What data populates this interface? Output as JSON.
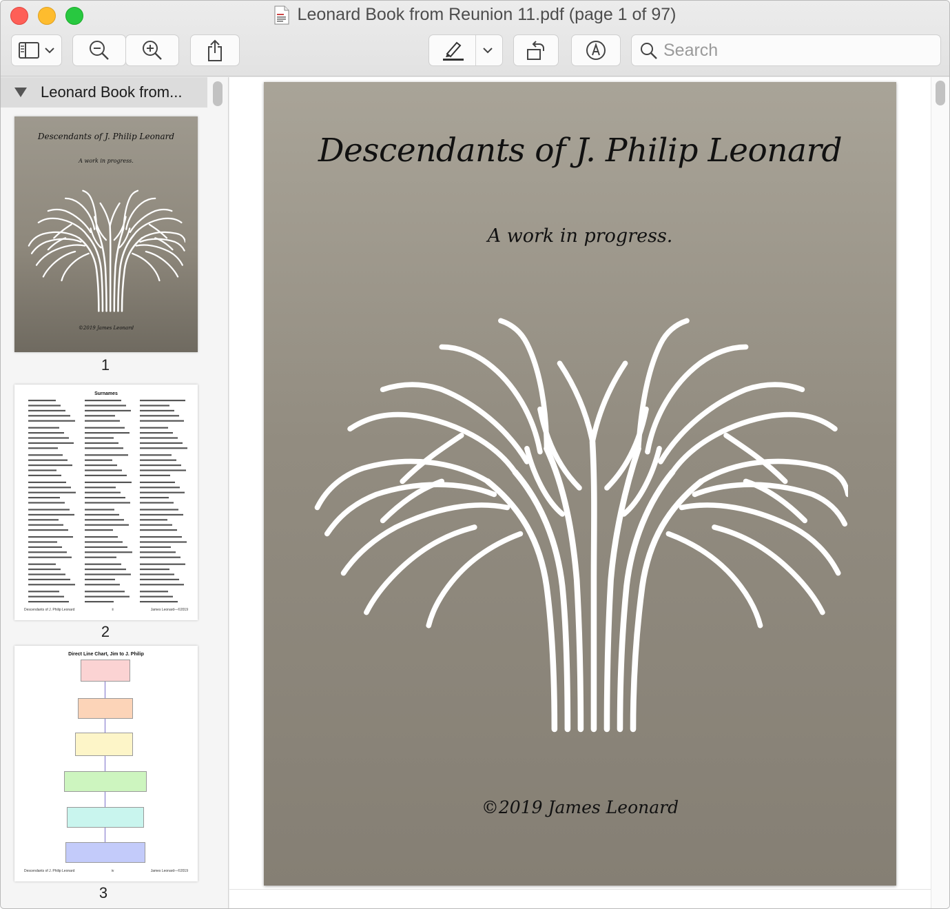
{
  "window": {
    "title": "Leonard Book from Reunion 11.pdf (page 1 of 97)"
  },
  "toolbar": {
    "search_placeholder": "Search",
    "icons": [
      "sidebar-icon",
      "chevron-down-icon",
      "zoom-out-icon",
      "zoom-in-icon",
      "share-icon",
      "highlight-pen-icon",
      "chevron-down-icon",
      "rotate-icon",
      "markup-icon",
      "search-icon"
    ]
  },
  "sidebar": {
    "header": "Leonard Book from...",
    "thumbnails": [
      {
        "page": "1",
        "title": "Descendants of J. Philip Leonard",
        "subtitle": "A work in progress.",
        "copyright": "©2019 James Leonard"
      },
      {
        "page": "2",
        "heading": "Surnames",
        "footer_left": "Descendants of J. Philip Leonard",
        "footer_mid": "ii",
        "footer_right": "James Leonard—©2019"
      },
      {
        "page": "3",
        "heading": "Direct Line Chart, Jim to J. Philip",
        "footer_left": "Descendants of J. Philip Leonard",
        "footer_mid": "iv",
        "footer_right": "James Leonard—©2019"
      }
    ]
  },
  "document": {
    "title": "Descendants of J. Philip Leonard",
    "subtitle": "A work in progress.",
    "copyright": "©2019 James Leonard"
  },
  "colors": {
    "page_top": "#a9a498",
    "page_bottom": "#857f74",
    "tree": "#ffffff"
  }
}
